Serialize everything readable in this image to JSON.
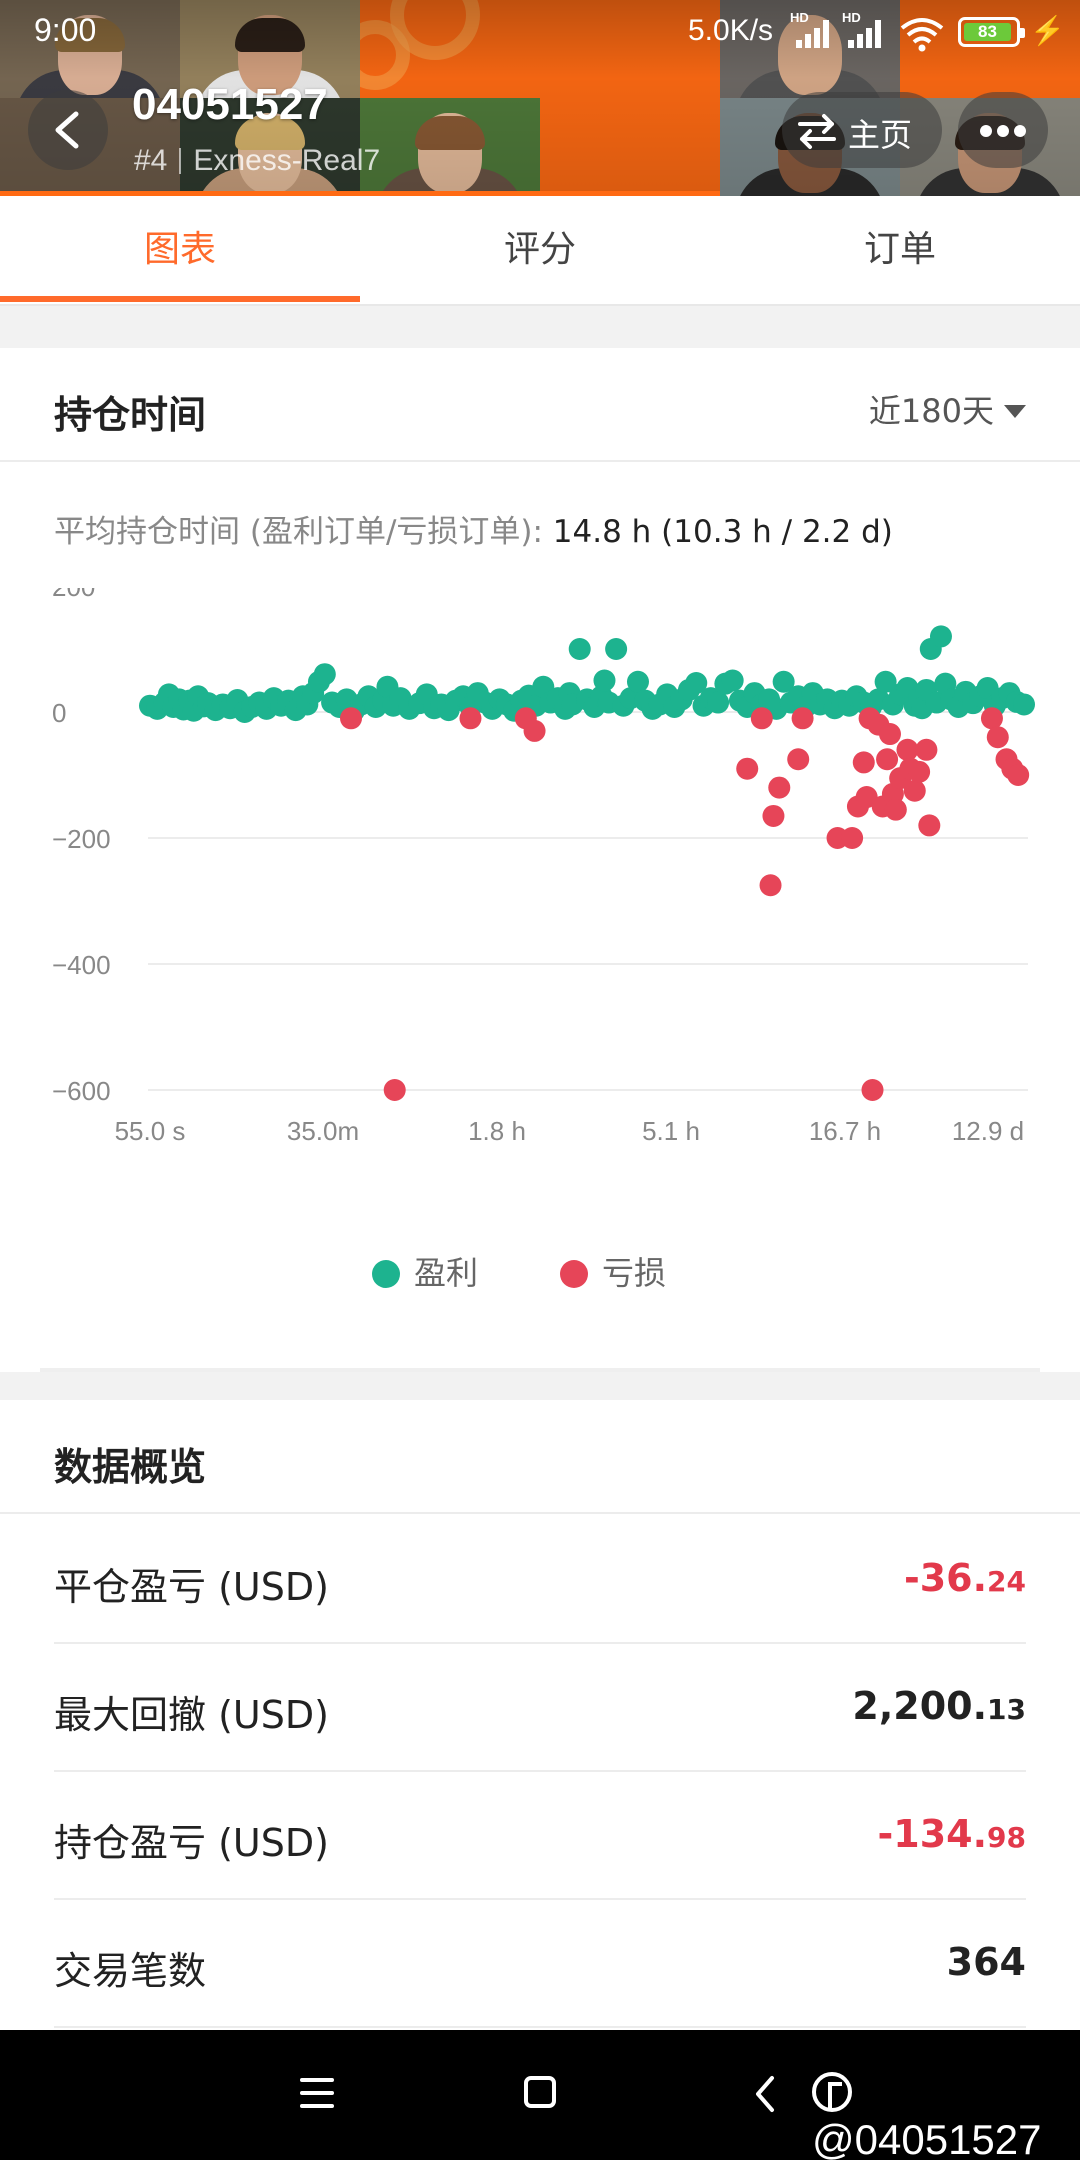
{
  "status_bar": {
    "time": "9:00",
    "net_speed": "5.0K/s",
    "battery": "83"
  },
  "header": {
    "account_number": "04051527",
    "rank": "#4",
    "server": "Exness-Real7",
    "home_label": "主页",
    "accent_color": "#ff6a13"
  },
  "tabs": [
    {
      "label": "图表",
      "active": true
    },
    {
      "label": "评分",
      "active": false
    },
    {
      "label": "订单",
      "active": false
    }
  ],
  "holding_card": {
    "title": "持仓时间",
    "range_label": "近180天",
    "avg_label": "平均持仓时间 (盈利订单/亏损订单):",
    "avg_value": "14.8 h (10.3 h / 2.2 d)"
  },
  "chart_data": {
    "type": "scatter",
    "title": "",
    "xlabel": "",
    "ylabel": "",
    "y_ticks": [
      200,
      0,
      -200,
      -400,
      -600
    ],
    "y_tick_labels": [
      "200",
      "0",
      "−200",
      "−400",
      "−600"
    ],
    "ylim": [
      -600,
      200
    ],
    "x_tick_labels": [
      "55.0 s",
      "35.0m",
      "1.8 h",
      "5.1 h",
      "16.7 h",
      "12.9 d"
    ],
    "x_axis_note": "non-linear holding-time scale; x given as position index 0-5 between tick labels",
    "grid": true,
    "legend_position": "bottom",
    "series": [
      {
        "name": "盈利",
        "color": "#1db38f",
        "points": [
          [
            0.0,
            10
          ],
          [
            0.05,
            5
          ],
          [
            0.1,
            15
          ],
          [
            0.13,
            28
          ],
          [
            0.16,
            8
          ],
          [
            0.2,
            20
          ],
          [
            0.23,
            4
          ],
          [
            0.27,
            18
          ],
          [
            0.3,
            2
          ],
          [
            0.33,
            25
          ],
          [
            0.37,
            9
          ],
          [
            0.4,
            14
          ],
          [
            0.45,
            3
          ],
          [
            0.5,
            12
          ],
          [
            0.55,
            6
          ],
          [
            0.6,
            19
          ],
          [
            0.65,
            0
          ],
          [
            0.7,
            8
          ],
          [
            0.75,
            15
          ],
          [
            0.8,
            5
          ],
          [
            0.85,
            22
          ],
          [
            0.9,
            10
          ],
          [
            0.95,
            18
          ],
          [
            1.0,
            3
          ],
          [
            1.05,
            25
          ],
          [
            1.08,
            12
          ],
          [
            1.12,
            30
          ],
          [
            1.16,
            48
          ],
          [
            1.2,
            60
          ],
          [
            1.25,
            15
          ],
          [
            1.3,
            8
          ],
          [
            1.35,
            20
          ],
          [
            1.4,
            2
          ],
          [
            1.45,
            12
          ],
          [
            1.5,
            25
          ],
          [
            1.55,
            8
          ],
          [
            1.6,
            18
          ],
          [
            1.63,
            40
          ],
          [
            1.67,
            10
          ],
          [
            1.72,
            22
          ],
          [
            1.78,
            5
          ],
          [
            1.85,
            14
          ],
          [
            1.9,
            28
          ],
          [
            1.95,
            6
          ],
          [
            2.0,
            12
          ],
          [
            2.05,
            3
          ],
          [
            2.1,
            18
          ],
          [
            2.15,
            25
          ],
          [
            2.2,
            8
          ],
          [
            2.25,
            30
          ],
          [
            2.3,
            15
          ],
          [
            2.35,
            5
          ],
          [
            2.4,
            20
          ],
          [
            2.45,
            12
          ],
          [
            2.5,
            2
          ],
          [
            2.55,
            18
          ],
          [
            2.6,
            26
          ],
          [
            2.65,
            10
          ],
          [
            2.7,
            40
          ],
          [
            2.75,
            15
          ],
          [
            2.8,
            22
          ],
          [
            2.85,
            5
          ],
          [
            2.88,
            30
          ],
          [
            2.9,
            12
          ],
          [
            2.95,
            100
          ],
          [
            3.0,
            20
          ],
          [
            3.05,
            8
          ],
          [
            3.1,
            25
          ],
          [
            3.12,
            50
          ],
          [
            3.15,
            15
          ],
          [
            3.2,
            100
          ],
          [
            3.25,
            10
          ],
          [
            3.3,
            22
          ],
          [
            3.35,
            48
          ],
          [
            3.4,
            18
          ],
          [
            3.45,
            5
          ],
          [
            3.5,
            12
          ],
          [
            3.55,
            28
          ],
          [
            3.6,
            8
          ],
          [
            3.65,
            20
          ],
          [
            3.7,
            35
          ],
          [
            3.75,
            46
          ],
          [
            3.8,
            10
          ],
          [
            3.85,
            22
          ],
          [
            3.9,
            15
          ],
          [
            3.95,
            45
          ],
          [
            4.0,
            50
          ],
          [
            4.05,
            18
          ],
          [
            4.1,
            8
          ],
          [
            4.15,
            30
          ],
          [
            4.2,
            12
          ],
          [
            4.25,
            20
          ],
          [
            4.3,
            5
          ],
          [
            4.35,
            48
          ],
          [
            4.4,
            15
          ],
          [
            4.45,
            25
          ],
          [
            4.5,
            8
          ],
          [
            4.55,
            30
          ],
          [
            4.6,
            12
          ],
          [
            4.65,
            20
          ],
          [
            4.7,
            6
          ],
          [
            4.75,
            18
          ],
          [
            4.8,
            10
          ],
          [
            4.85,
            25
          ],
          [
            4.9,
            15
          ],
          [
            4.95,
            8
          ],
          [
            5.0,
            20
          ],
          [
            5.05,
            48
          ],
          [
            5.1,
            12
          ],
          [
            5.15,
            28
          ],
          [
            5.2,
            38
          ],
          [
            5.25,
            10
          ],
          [
            5.28,
            22
          ],
          [
            5.3,
            6
          ],
          [
            5.33,
            35
          ],
          [
            5.36,
            100
          ],
          [
            5.4,
            15
          ],
          [
            5.43,
            120
          ],
          [
            5.46,
            45
          ],
          [
            5.5,
            20
          ],
          [
            5.55,
            8
          ],
          [
            5.6,
            32
          ],
          [
            5.65,
            14
          ],
          [
            5.7,
            25
          ],
          [
            5.75,
            38
          ],
          [
            5.8,
            10
          ],
          [
            5.85,
            22
          ],
          [
            5.9,
            30
          ],
          [
            5.95,
            16
          ],
          [
            6.0,
            12
          ]
        ]
      },
      {
        "name": "亏损",
        "color": "#e64558",
        "points": [
          [
            1.38,
            -10
          ],
          [
            1.68,
            -600
          ],
          [
            2.2,
            -10
          ],
          [
            2.58,
            -10
          ],
          [
            2.64,
            -30
          ],
          [
            4.1,
            -90
          ],
          [
            4.2,
            -10
          ],
          [
            4.26,
            -275
          ],
          [
            4.28,
            -165
          ],
          [
            4.32,
            -120
          ],
          [
            4.45,
            -75
          ],
          [
            4.48,
            -10
          ],
          [
            4.72,
            -200
          ],
          [
            4.82,
            -200
          ],
          [
            4.86,
            -150
          ],
          [
            4.9,
            -80
          ],
          [
            4.92,
            -135
          ],
          [
            4.94,
            -10
          ],
          [
            4.96,
            -600
          ],
          [
            5.0,
            -20
          ],
          [
            5.03,
            -150
          ],
          [
            5.06,
            -75
          ],
          [
            5.08,
            -35
          ],
          [
            5.1,
            -130
          ],
          [
            5.12,
            -155
          ],
          [
            5.15,
            -105
          ],
          [
            5.2,
            -60
          ],
          [
            5.22,
            -90
          ],
          [
            5.25,
            -125
          ],
          [
            5.28,
            -95
          ],
          [
            5.33,
            -60
          ],
          [
            5.35,
            -180
          ],
          [
            5.78,
            -10
          ],
          [
            5.82,
            -40
          ],
          [
            5.88,
            -75
          ],
          [
            5.92,
            -90
          ],
          [
            5.96,
            -100
          ]
        ]
      }
    ]
  },
  "overview": {
    "title": "数据概览",
    "rows": [
      {
        "label": "平仓盈亏 (USD)",
        "value_main": "-36.",
        "value_dec": "24",
        "negative": true
      },
      {
        "label": "最大回撤 (USD)",
        "value_main": "2,200.",
        "value_dec": "13",
        "negative": false
      },
      {
        "label": "持仓盈亏 (USD)",
        "value_main": "-134.",
        "value_dec": "98",
        "negative": true
      },
      {
        "label": "交易笔数",
        "value_main": "364",
        "value_dec": "",
        "negative": false
      }
    ]
  },
  "navbar": {
    "watermark": "@04051527"
  }
}
